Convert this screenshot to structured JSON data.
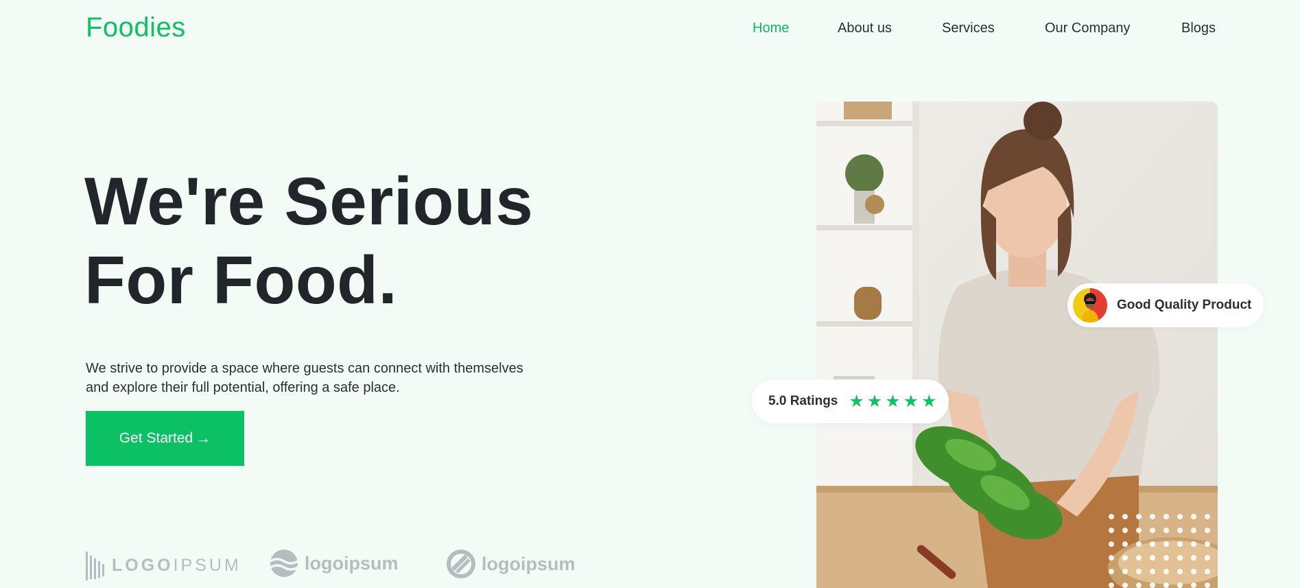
{
  "brand": "Foodies",
  "nav": {
    "items": [
      {
        "label": "Home",
        "active": true
      },
      {
        "label": "About us",
        "active": false
      },
      {
        "label": "Services",
        "active": false
      },
      {
        "label": "Our Company",
        "active": false
      },
      {
        "label": "Blogs",
        "active": false
      }
    ]
  },
  "hero": {
    "title_line1": "We're Serious",
    "title_line2": "For Food.",
    "description": "We strive to provide a space where guests can connect with themselves and explore their full potential, offering a safe place.",
    "cta_label": "Get Started",
    "cta_icon": "arrow-right-icon"
  },
  "logos": [
    {
      "text_bold": "LOGO",
      "text_light": "IPSUM",
      "icon": "barcode-icon"
    },
    {
      "text": "logoipsum",
      "icon": "waves-icon"
    },
    {
      "text": "logoipsum",
      "icon": "ring-icon"
    }
  ],
  "badges": {
    "quality": {
      "label": "Good Quality Product",
      "icon": "avatar"
    },
    "rating": {
      "label": "5.0 Ratings",
      "stars": 5,
      "star_icon": "star-icon"
    }
  },
  "colors": {
    "accent": "#0fc065",
    "background": "#f3fbf6",
    "text": "#22262a",
    "logo_gray": "#b6bcbf"
  }
}
